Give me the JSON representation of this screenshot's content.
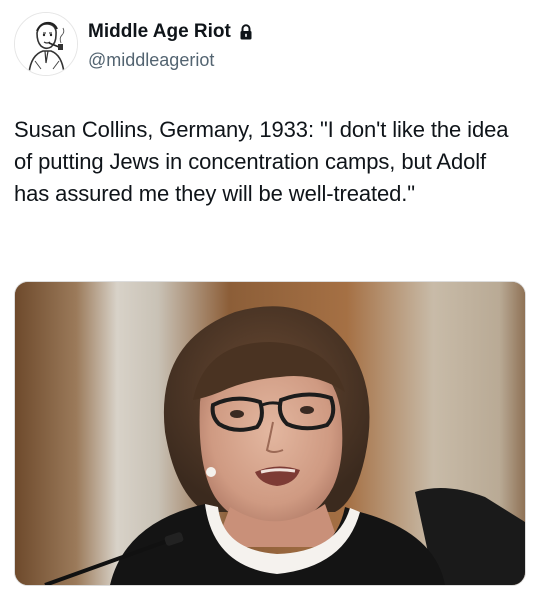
{
  "author": {
    "display_name": "Middle Age Riot",
    "handle": "@middleageriot",
    "avatar_icon": "sketch-man-with-pipe-avatar",
    "protected_icon": "lock-icon"
  },
  "tweet": {
    "text": "Susan Collins, Germany, 1933: \"I don't like the idea of putting Jews in concentration camps, but Adolf has assured me they will be well-treated.\""
  },
  "media": {
    "kind": "photo"
  },
  "colors": {
    "text_primary": "#0f1419",
    "text_secondary": "#536471",
    "background": "#ffffff"
  }
}
